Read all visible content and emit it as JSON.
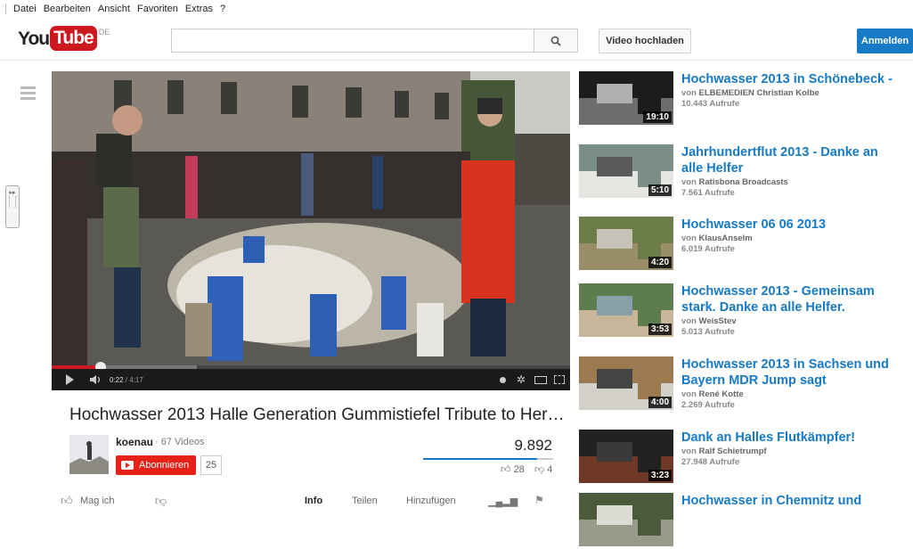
{
  "menu": [
    "Datei",
    "Bearbeiten",
    "Ansicht",
    "Favoriten",
    "Extras",
    "?"
  ],
  "logo": {
    "you": "You",
    "tube": "Tube",
    "country": "DE"
  },
  "search": {
    "placeholder": ""
  },
  "header": {
    "upload_label": "Video hochladen",
    "signin_label": "Anmelden"
  },
  "player": {
    "time_current": "0:22",
    "time_total": "4:17",
    "progress": 0.095,
    "loaded": 0.28
  },
  "video": {
    "title": "Hochwasser 2013 Halle Generation Gummistiefel Tribute to Her…",
    "channel": "koenau",
    "video_count": "· 67 Videos",
    "subscribe_label": "Abonnieren",
    "subscriber_count": "25",
    "views": "9.892",
    "likes": "28",
    "dislikes": "4",
    "like_ratio": 0.875
  },
  "actions": {
    "like": "Mag ich",
    "info": "Info",
    "share": "Teilen",
    "add": "Hinzufügen"
  },
  "recommendations": [
    {
      "title": "Hochwasser 2013 in Schönebeck -",
      "by_prefix": "von",
      "channel": "ELBEMEDIEN Christian Kolbe",
      "views": "10.443 Aufrufe",
      "duration": "19:10"
    },
    {
      "title": "Jahrhundertflut 2013 - Danke an alle Helfer",
      "by_prefix": "von",
      "channel": "Ratisbona Broadcasts",
      "views": "7.561 Aufrufe",
      "duration": "5:10"
    },
    {
      "title": "Hochwasser 06 06 2013",
      "by_prefix": "von",
      "channel": "KlausAnselm",
      "views": "6.019 Aufrufe",
      "duration": "4:20"
    },
    {
      "title": "Hochwasser 2013 - Gemeinsam stark. Danke an alle Helfer.",
      "by_prefix": "von",
      "channel": "WeisStev",
      "views": "5.013 Aufrufe",
      "duration": "3:53"
    },
    {
      "title": "Hochwasser 2013 in Sachsen und Bayern MDR Jump sagt",
      "by_prefix": "von",
      "channel": "René Kotte",
      "views": "2.269 Aufrufe",
      "duration": "4:00"
    },
    {
      "title": "Dank an Halles Flutkämpfer!",
      "by_prefix": "von",
      "channel": "Ralf Schietrumpf",
      "views": "27.948 Aufrufe",
      "duration": "3:23"
    },
    {
      "title": "Hochwasser in Chemnitz und",
      "by_prefix": "",
      "channel": "",
      "views": "",
      "duration": ""
    }
  ],
  "colors": {
    "accent": "#167ac6",
    "brand_red": "#cc181e",
    "subscribe_red": "#e62117"
  }
}
